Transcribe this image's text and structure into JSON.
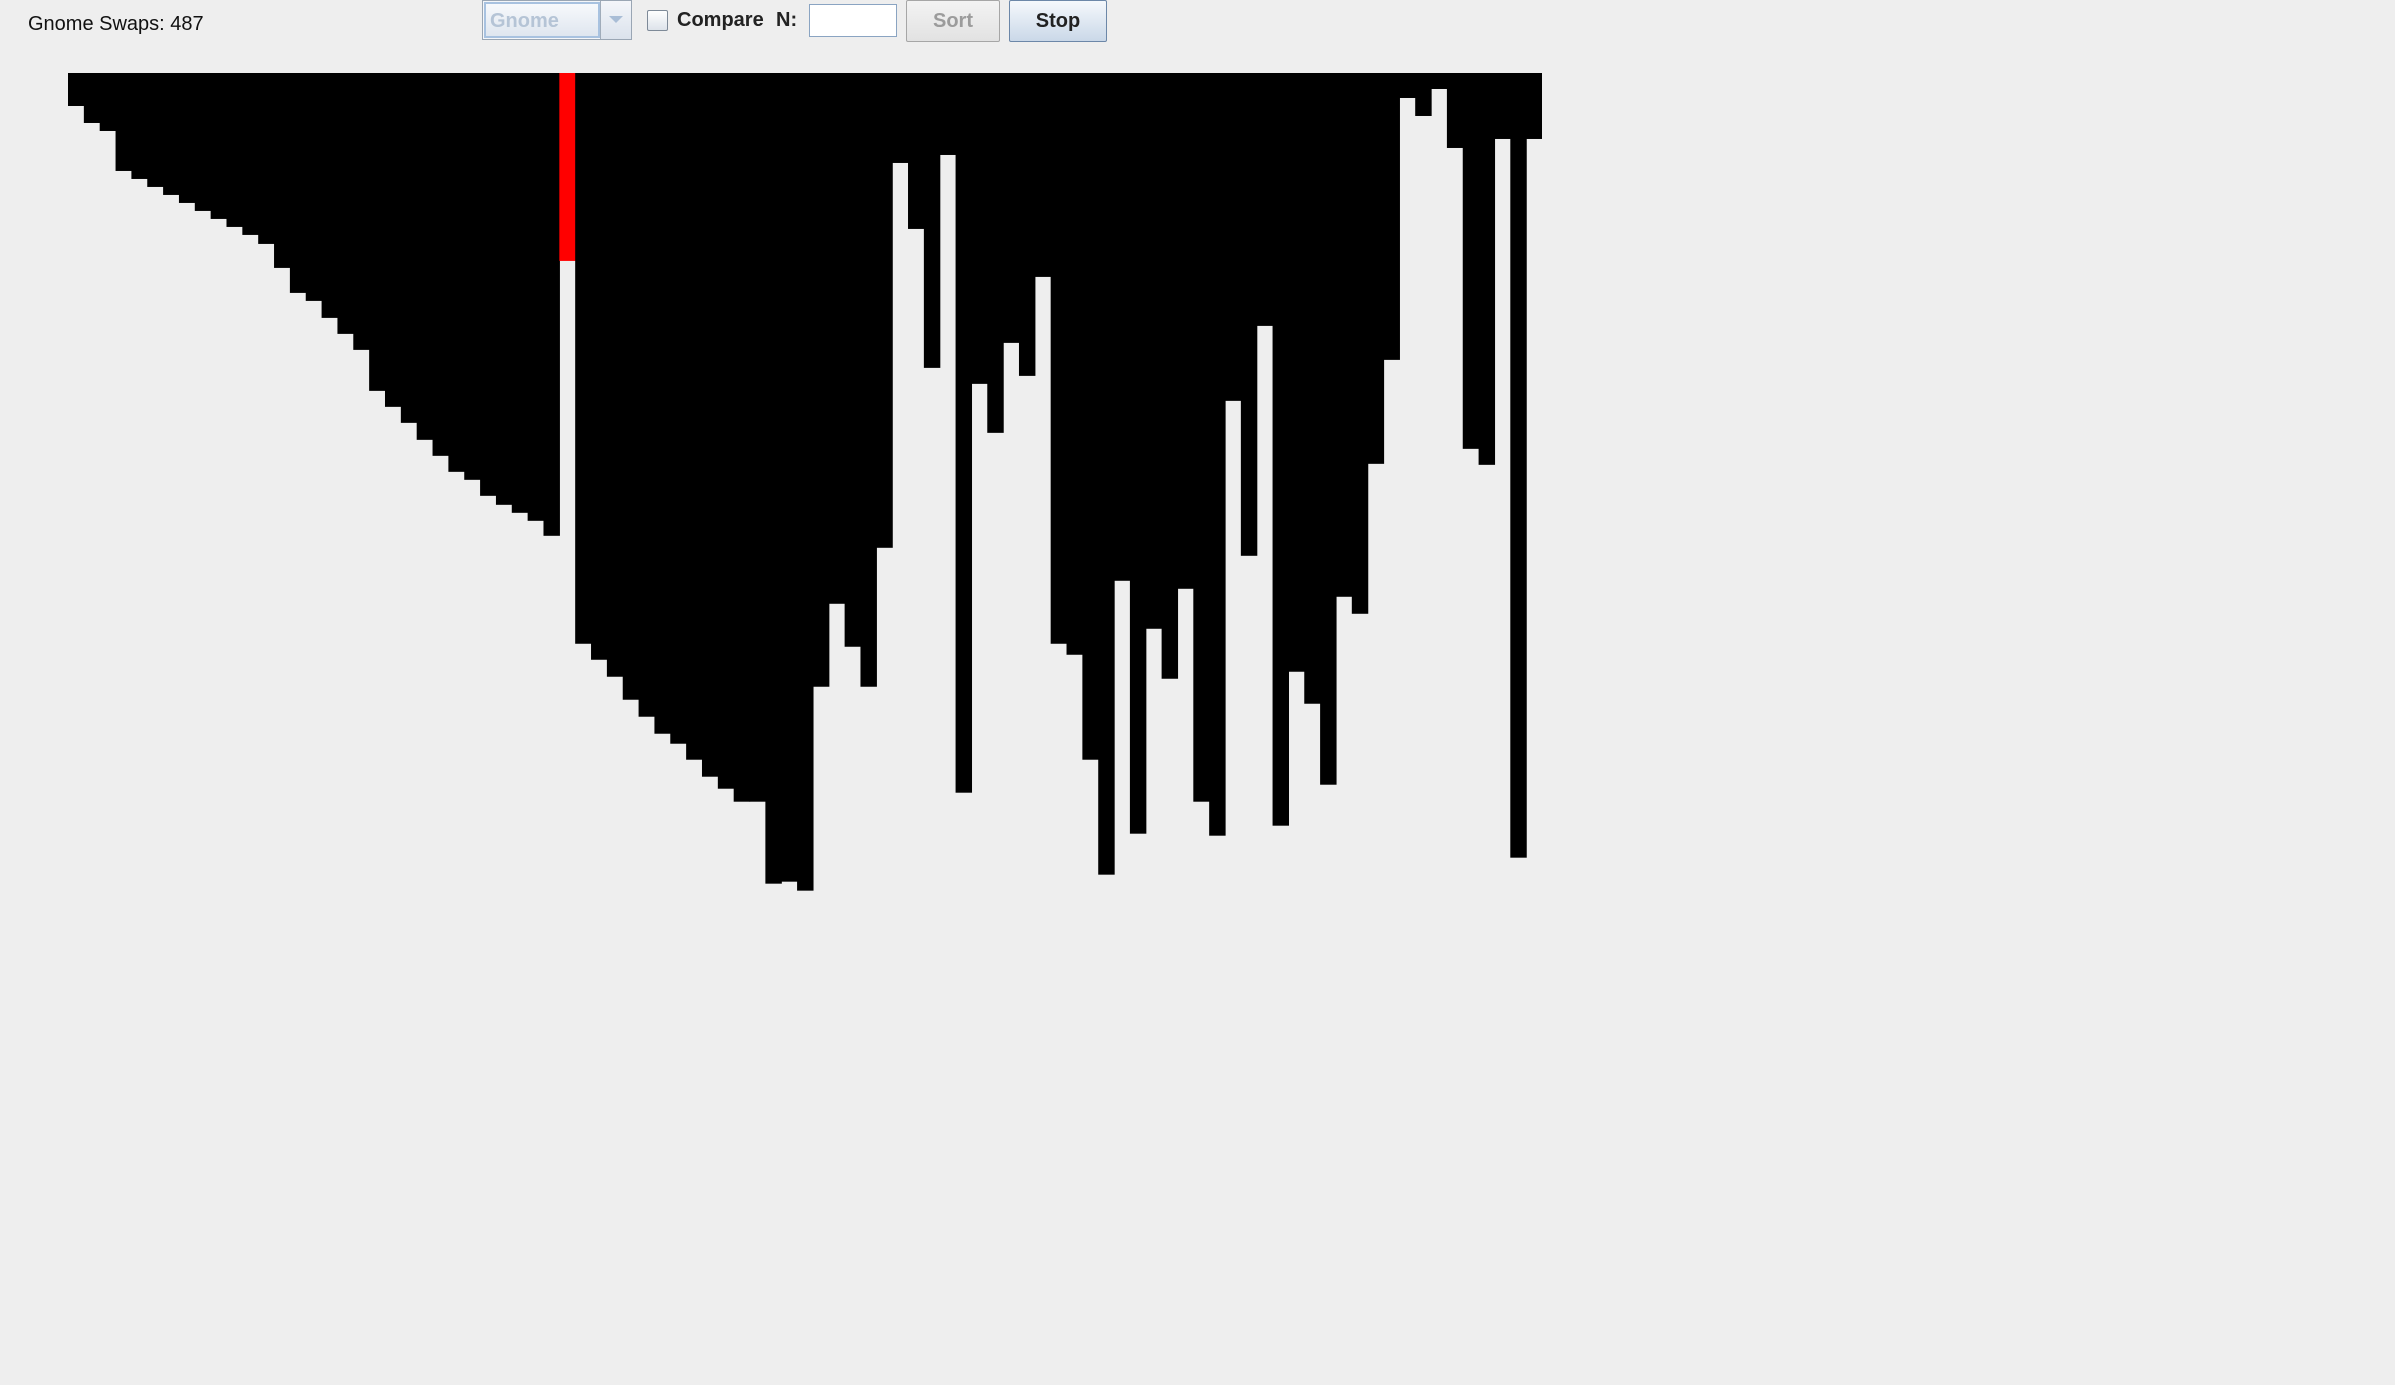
{
  "status": {
    "swaps_label": "Gnome Swaps: 487"
  },
  "toolbar": {
    "algorithm_select": {
      "selected": "Gnome",
      "enabled": false
    },
    "compare_checkbox": {
      "label": "Compare",
      "checked": false
    },
    "n_field": {
      "label": "N:",
      "value": ""
    },
    "sort_button": {
      "label": "Sort",
      "enabled": false
    },
    "stop_button": {
      "label": "Stop",
      "enabled": true
    }
  },
  "colors": {
    "background": "#eeeeee",
    "bar": "#000000",
    "active_bar": "#ff0000"
  },
  "chart_data": {
    "type": "bar",
    "orientation": "hanging-from-top",
    "ylim": [
      0,
      826
    ],
    "active_index": 31,
    "values": [
      33,
      50,
      58,
      98,
      106,
      114,
      122,
      130,
      138,
      146,
      154,
      162,
      171,
      195,
      220,
      228,
      245,
      261,
      277,
      318,
      334,
      350,
      367,
      383,
      399,
      407,
      423,
      432,
      440,
      448,
      463,
      188,
      571,
      587,
      604,
      627,
      644,
      661,
      671,
      687,
      704,
      716,
      729,
      729,
      811,
      809,
      818,
      614,
      531,
      574,
      614,
      475,
      90,
      156,
      295,
      82,
      720,
      311,
      360,
      270,
      303,
      204,
      571,
      582,
      687,
      802,
      508,
      761,
      556,
      606,
      516,
      729,
      763,
      328,
      483,
      253,
      753,
      599,
      631,
      712,
      524,
      541,
      391,
      287,
      25,
      43,
      16,
      75,
      376,
      392,
      66,
      785,
      66
    ]
  }
}
